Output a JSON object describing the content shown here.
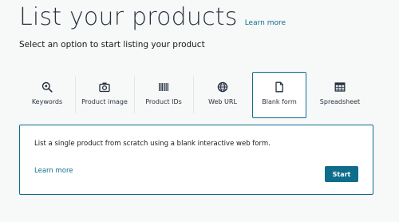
{
  "header": {
    "title": "List your products",
    "learn_more": "Learn more",
    "subtitle": "Select an option to start listing your product"
  },
  "options": [
    {
      "label": "Keywords",
      "icon": "search-icon"
    },
    {
      "label": "Product image",
      "icon": "camera-icon"
    },
    {
      "label": "Product IDs",
      "icon": "barcode-icon"
    },
    {
      "label": "Web URL",
      "icon": "globe-icon"
    },
    {
      "label": "Blank form",
      "icon": "document-icon",
      "selected": true
    },
    {
      "label": "Spreadsheet",
      "icon": "spreadsheet-icon"
    }
  ],
  "panel": {
    "description": "List a single product from scratch using a blank interactive web form.",
    "learn_more": "Learn more",
    "start_label": "Start"
  },
  "colors": {
    "accent": "#0f6d8c",
    "background": "#f7f8f8",
    "card": "#ffffff"
  }
}
